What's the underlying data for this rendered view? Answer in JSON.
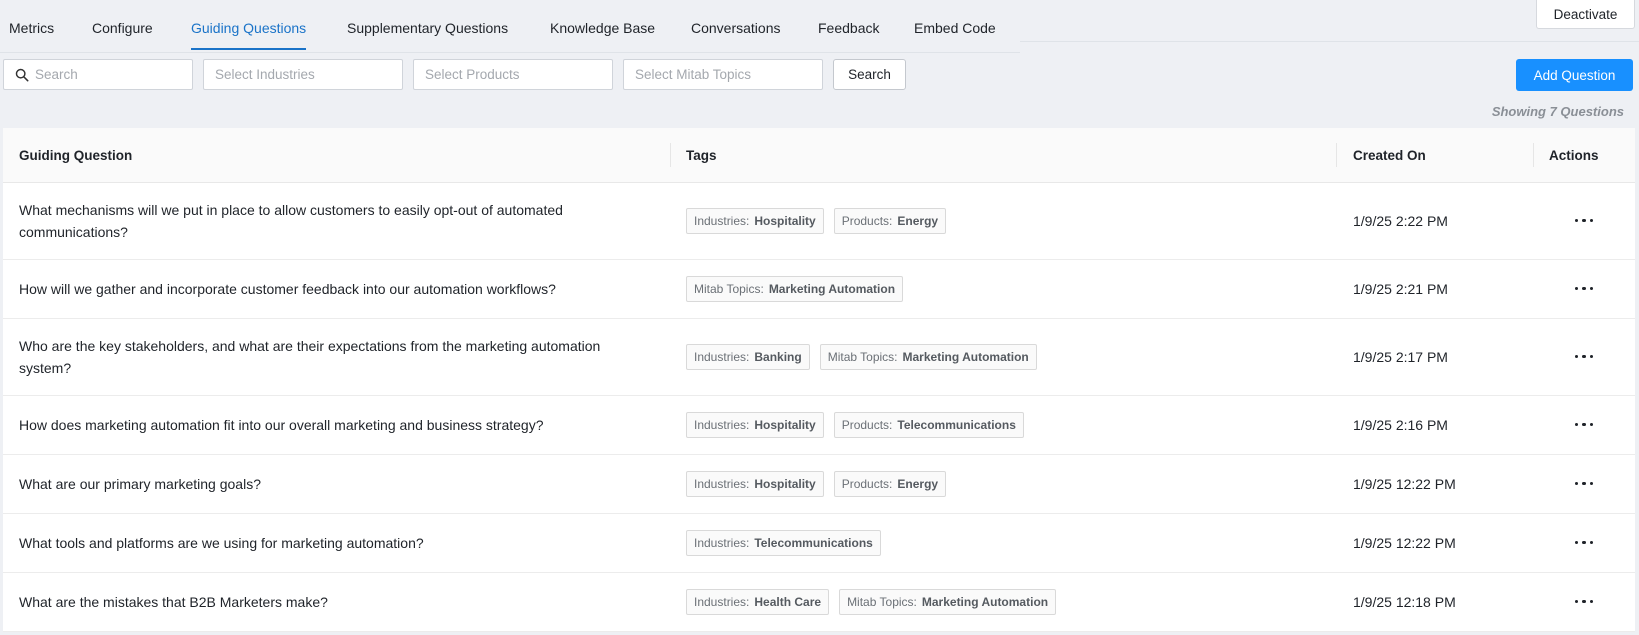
{
  "tabs": [
    {
      "label": "Metrics",
      "active": false
    },
    {
      "label": "Configure",
      "active": false
    },
    {
      "label": "Guiding Questions",
      "active": true
    },
    {
      "label": "Supplementary Questions",
      "active": false
    },
    {
      "label": "Knowledge Base",
      "active": false
    },
    {
      "label": "Conversations",
      "active": false
    },
    {
      "label": "Feedback",
      "active": false
    },
    {
      "label": "Embed Code",
      "active": false
    }
  ],
  "deactivate_label": "Deactivate",
  "filters": {
    "search_placeholder": "Search",
    "industries_placeholder": "Select Industries",
    "products_placeholder": "Select Products",
    "topics_placeholder": "Select Mitab Topics",
    "search_button": "Search"
  },
  "add_question_label": "Add Question",
  "showing_text": "Showing 7 Questions",
  "table": {
    "headers": {
      "question": "Guiding Question",
      "tags": "Tags",
      "created": "Created On",
      "actions": "Actions"
    },
    "rows": [
      {
        "question": "What mechanisms will we put in place to allow customers to easily opt-out of automated communications?",
        "tags": [
          {
            "key": "Industries:",
            "value": "Hospitality"
          },
          {
            "key": "Products:",
            "value": "Energy"
          }
        ],
        "created": "1/9/25 2:22 PM"
      },
      {
        "question": "How will we gather and incorporate customer feedback into our automation workflows?",
        "tags": [
          {
            "key": "Mitab Topics:",
            "value": "Marketing Automation"
          }
        ],
        "created": "1/9/25 2:21 PM"
      },
      {
        "question": "Who are the key stakeholders, and what are their expectations from the marketing automation system?",
        "tags": [
          {
            "key": "Industries:",
            "value": "Banking"
          },
          {
            "key": "Mitab Topics:",
            "value": "Marketing Automation"
          }
        ],
        "created": "1/9/25 2:17 PM"
      },
      {
        "question": "How does marketing automation fit into our overall marketing and business strategy?",
        "tags": [
          {
            "key": "Industries:",
            "value": "Hospitality"
          },
          {
            "key": "Products:",
            "value": "Telecommunications"
          }
        ],
        "created": "1/9/25 2:16 PM"
      },
      {
        "question": "What are our primary marketing goals?",
        "tags": [
          {
            "key": "Industries:",
            "value": "Hospitality"
          },
          {
            "key": "Products:",
            "value": "Energy"
          }
        ],
        "created": "1/9/25 12:22 PM"
      },
      {
        "question": "What tools and platforms are we using for marketing automation?",
        "tags": [
          {
            "key": "Industries:",
            "value": "Telecommunications"
          }
        ],
        "created": "1/9/25 12:22 PM"
      },
      {
        "question": "What are the mistakes that B2B Marketers make?",
        "tags": [
          {
            "key": "Industries:",
            "value": "Health Care"
          },
          {
            "key": "Mitab Topics:",
            "value": "Marketing Automation"
          }
        ],
        "created": "1/9/25 12:18 PM"
      }
    ]
  },
  "icons": {
    "search": "search-icon",
    "row_actions": "more-horizontal-icon"
  },
  "colors": {
    "primary": "#1890ff",
    "active_tab": "#1a73c8",
    "background": "#eef0f4"
  }
}
